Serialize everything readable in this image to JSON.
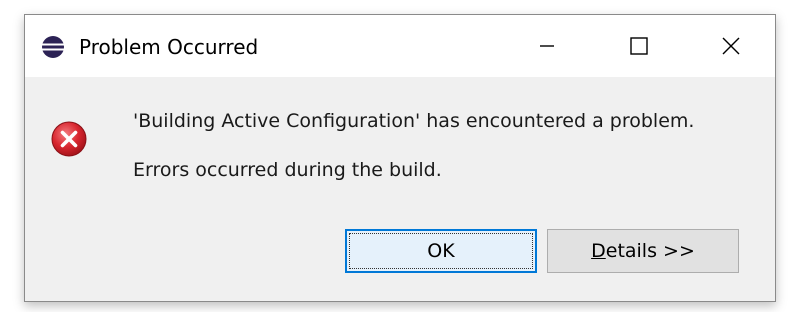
{
  "window": {
    "title": "Problem Occurred",
    "app_icon": "eclipse-icon",
    "controls": {
      "minimize_icon": "minimize-icon",
      "maximize_icon": "maximize-icon",
      "close_icon": "close-icon"
    }
  },
  "content": {
    "status_icon": "error-icon",
    "message_line1": "'Building Active Configuration' has encountered a problem.",
    "message_line2": "Errors occurred during the build."
  },
  "buttons": {
    "ok_label": "OK",
    "details_mnemonic": "D",
    "details_rest": "etails >>"
  },
  "colors": {
    "error_red": "#d8262f",
    "focus_blue": "#0078d7",
    "eclipse_purple": "#2c2255"
  }
}
